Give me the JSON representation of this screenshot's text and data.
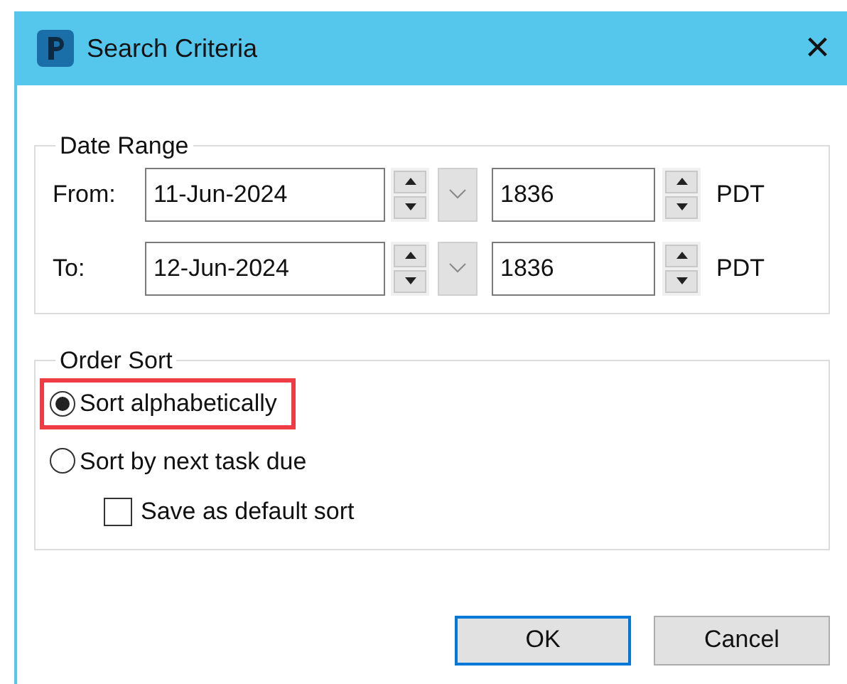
{
  "window": {
    "title": "Search Criteria",
    "close": "×"
  },
  "date_range": {
    "legend": "Date Range",
    "rows": [
      {
        "label": "From:",
        "date": "11-Jun-2024",
        "time": "1836",
        "zone": "PDT"
      },
      {
        "label": "To:",
        "date": "12-Jun-2024",
        "time": "1836",
        "zone": "PDT"
      }
    ]
  },
  "order_sort": {
    "legend": "Order Sort",
    "options": [
      {
        "label": "Sort alphabetically",
        "selected": true,
        "highlighted": true
      },
      {
        "label": "Sort by next task due",
        "selected": false,
        "highlighted": false
      }
    ],
    "checkbox": {
      "label": "Save as default sort",
      "checked": false
    }
  },
  "buttons": [
    {
      "label": "OK",
      "default": true
    },
    {
      "label": "Cancel",
      "default": false
    }
  ]
}
